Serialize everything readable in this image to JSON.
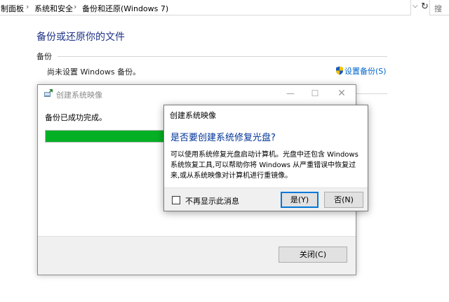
{
  "address_bar": {
    "breadcrumbs": [
      "制面板",
      "系统和安全",
      "备份和还原(Windows 7)"
    ],
    "search_placeholder": "搜"
  },
  "main": {
    "title": "备份或还原你的文件",
    "group_label": "备份",
    "status_text": "尚未设置 Windows 备份。",
    "setup_link": "设置备份(S)"
  },
  "progress_window": {
    "title": "创建系统映像",
    "done_text": "备份已成功完成。",
    "progress": 1.0,
    "close_button": "关闭(C)"
  },
  "dialog": {
    "title": "创建系统映像",
    "main_instruction": "是否要创建系统修复光盘?",
    "body_lines": [
      "可以使用系统修复光盘启动计算机。光盘中还包含 Windows",
      "系统恢复工具,可以帮助你将 Windows 从严重错误中恢复过",
      "来,或从系统映像对计算机进行重镜像。"
    ],
    "checkbox_label": "不再显示此消息",
    "checkbox_checked": false,
    "yes_button": "是(Y)",
    "no_button": "否(N)"
  },
  "colors": {
    "title_blue": "#1e3287",
    "instruction_blue": "#003399",
    "link_blue": "#0066cc",
    "progress_green": "#06b025"
  }
}
